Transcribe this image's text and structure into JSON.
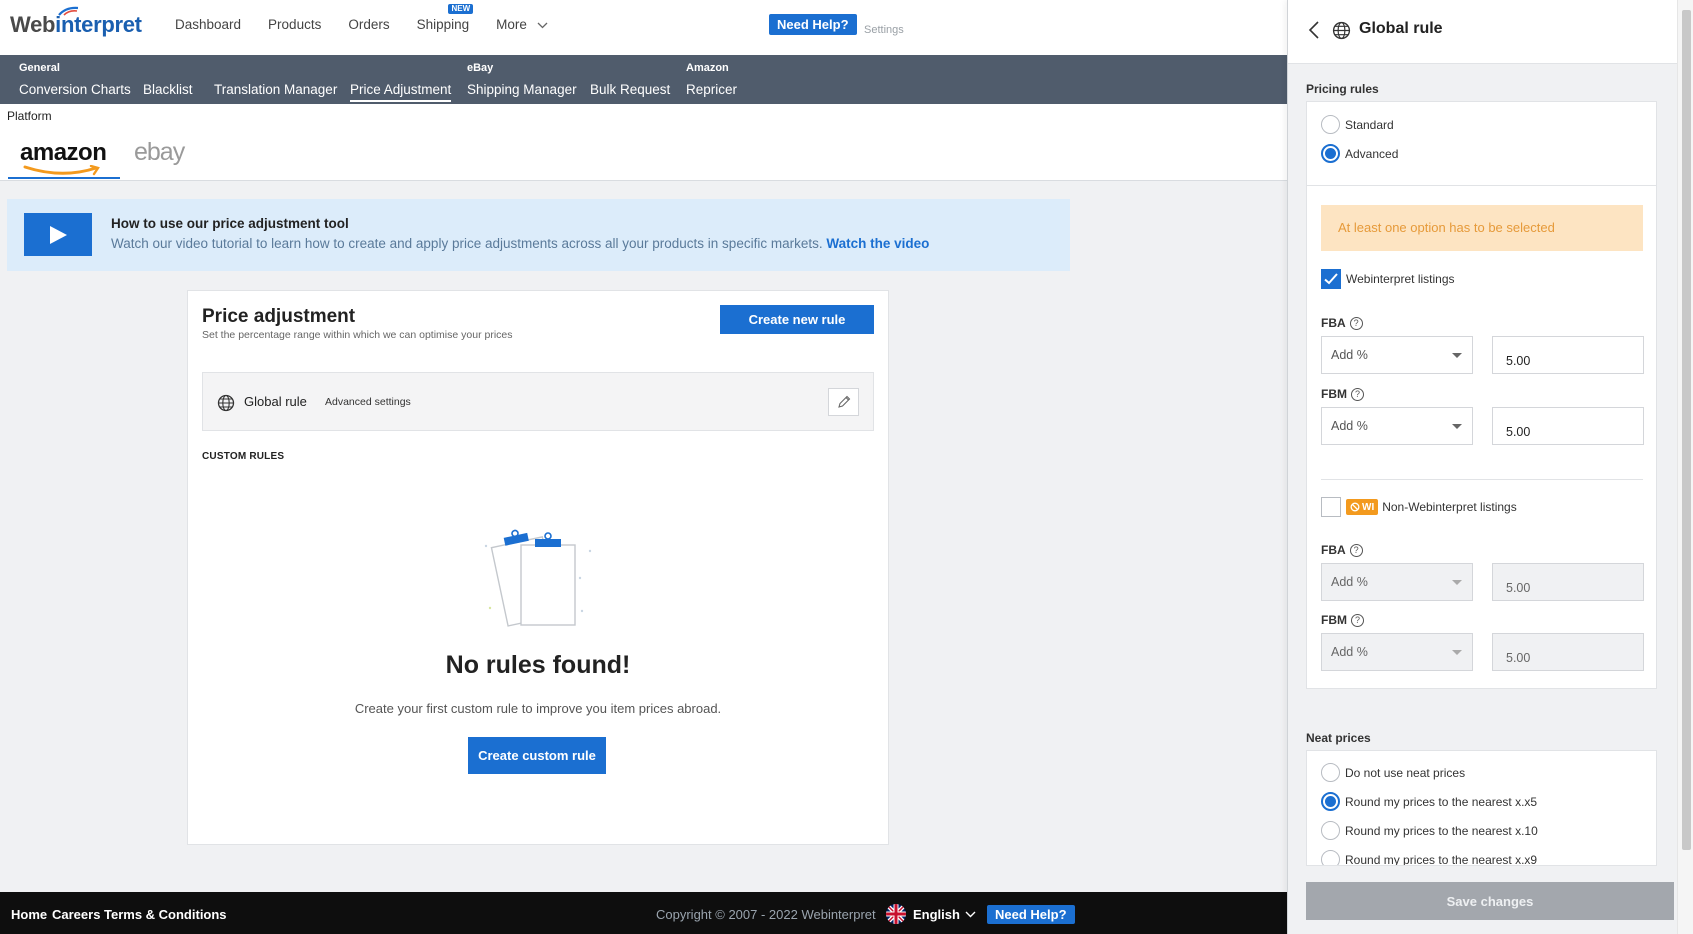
{
  "brand": {
    "name_part1": "Web",
    "name_part2": "interpret"
  },
  "nav": {
    "items": [
      "Dashboard",
      "Products",
      "Orders",
      "Shipping",
      "More"
    ],
    "new_badge": "NEW",
    "need_help": "Need Help?",
    "settings": "Settings"
  },
  "subnav": {
    "groups": {
      "general": "General",
      "ebay": "eBay",
      "amazon": "Amazon"
    },
    "items": [
      "Conversion Charts",
      "Blacklist",
      "Translation Manager",
      "Price Adjustment",
      "Shipping Manager",
      "Bulk Request",
      "Repricer"
    ],
    "active": "Price Adjustment"
  },
  "platform": {
    "label": "Platform",
    "amazon": "amazon",
    "ebay": "ebay"
  },
  "banner": {
    "title": "How to use our price adjustment tool",
    "desc": "Watch our video tutorial to learn how to create and apply price adjustments across all your products in specific markets.",
    "link": "Watch the video"
  },
  "card": {
    "title": "Price adjustment",
    "subtitle": "Set the percentage range within which we can optimise your prices",
    "create_new_rule": "Create new rule",
    "global_rule": "Global rule",
    "advanced_settings": "Advanced settings",
    "custom_rules_heading": "CUSTOM RULES",
    "empty_title": "No rules found!",
    "empty_desc": "Create your first custom rule to improve you item prices abroad.",
    "create_custom_rule": "Create custom rule"
  },
  "footer": {
    "links": [
      "Home",
      "Careers",
      "Terms & Conditions"
    ],
    "copyright": "Copyright © 2007 - 2022 Webinterpret",
    "language": "English",
    "need_help": "Need Help?"
  },
  "drawer": {
    "title": "Global rule",
    "pricing_rules_label": "Pricing rules",
    "pricing_options": [
      "Standard",
      "Advanced"
    ],
    "pricing_selected": "Advanced",
    "warning": "At least one option has to be selected",
    "wi_listings": {
      "label": "Webinterpret listings",
      "checked": true
    },
    "non_wi_listings": {
      "label": "Non-Webinterpret listings",
      "badge": "WI",
      "checked": false
    },
    "fba_label": "FBA",
    "fbm_label": "FBM",
    "select_value": "Add %",
    "wi_fba_value": "5.00",
    "wi_fbm_value": "5.00",
    "nwi_fba_value": "5.00",
    "nwi_fbm_value": "5.00",
    "neat_prices_label": "Neat prices",
    "neat_options": [
      "Do not use neat prices",
      "Round my prices to the nearest x.x5",
      "Round my prices to the nearest x.10",
      "Round my prices to the nearest x.x9"
    ],
    "neat_selected": "Round my prices to the nearest x.x5",
    "save_changes": "Save changes"
  },
  "colors": {
    "primary": "#1b6fd1",
    "subnav_bg": "#505c6c",
    "warning_bg": "#fde4c2",
    "warning_text": "#e69a3a",
    "wi_badge": "#f39a1e"
  }
}
